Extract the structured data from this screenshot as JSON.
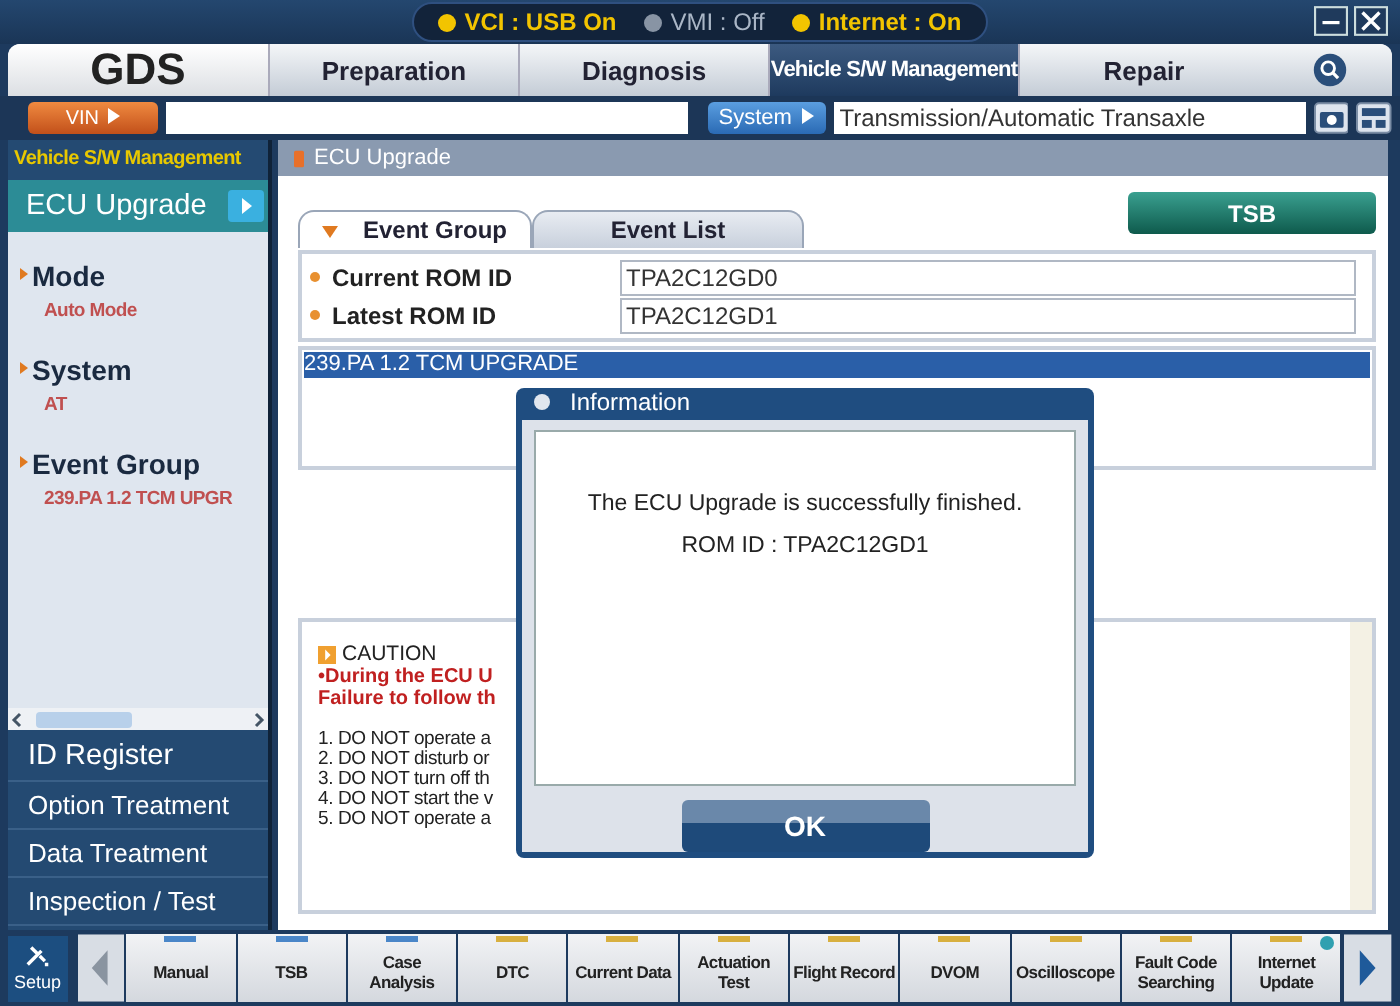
{
  "status_indicators": [
    {
      "label": "VCI : USB On",
      "on": true
    },
    {
      "label": "VMI : Off",
      "on": false
    },
    {
      "label": "Internet : On",
      "on": true
    }
  ],
  "logo": "GDS",
  "nav_tabs": [
    {
      "label": "Preparation",
      "selected": false
    },
    {
      "label": "Diagnosis",
      "selected": false
    },
    {
      "label": "Vehicle S/W Management",
      "selected": true
    },
    {
      "label": "Repair",
      "selected": false
    }
  ],
  "vin": {
    "button": "VIN"
  },
  "system": {
    "button": "System",
    "value": "Transmission/Automatic Transaxle"
  },
  "sidebar": {
    "title": "Vehicle S/W Management",
    "current": "ECU Upgrade",
    "sections": [
      {
        "label": "Mode",
        "value": "Auto Mode"
      },
      {
        "label": "System",
        "value": "AT"
      },
      {
        "label": "Event Group",
        "value": "239.PA 1.2 TCM UPGR"
      }
    ],
    "menu": [
      "ID Register",
      "Option Treatment",
      "Data Treatment",
      "Inspection / Test"
    ]
  },
  "breadcrumb": "ECU Upgrade",
  "content_tabs": [
    {
      "label": "Event Group",
      "selected": true
    },
    {
      "label": "Event List",
      "selected": false
    }
  ],
  "tsb_button": "TSB",
  "rom_ids": [
    {
      "label": "Current ROM ID",
      "value": "TPA2C12GD0"
    },
    {
      "label": "Latest ROM ID",
      "value": "TPA2C12GD1"
    }
  ],
  "events": [
    {
      "label": "239.PA 1.2 TCM UPGRADE",
      "selected": true
    }
  ],
  "caution": {
    "title": "CAUTION",
    "warning": [
      "•During the ECU U",
      "Failure to follow th"
    ],
    "steps": [
      "1. DO NOT operate a",
      "2. DO NOT disturb or",
      "3. DO NOT turn off th",
      "4. DO NOT start the v",
      "5. DO NOT operate a"
    ]
  },
  "dialog": {
    "title": "Information",
    "message": "The ECU Upgrade is successfully finished.",
    "detail": "ROM ID : TPA2C12GD1",
    "button": "OK"
  },
  "toolbar": {
    "setup": "Setup",
    "items": [
      {
        "label": "Manual",
        "color": "#4a86c8",
        "notice": false
      },
      {
        "label": "TSB",
        "color": "#4a86c8",
        "notice": false
      },
      {
        "label": "Case Analysis",
        "color": "#4a86c8",
        "notice": false
      },
      {
        "label": "DTC",
        "color": "#d8b040",
        "notice": false
      },
      {
        "label": "Current Data",
        "color": "#d8b040",
        "notice": false
      },
      {
        "label": "Actuation Test",
        "color": "#d8b040",
        "notice": false
      },
      {
        "label": "Flight Record",
        "color": "#d8b040",
        "notice": false
      },
      {
        "label": "DVOM",
        "color": "#d8b040",
        "notice": false
      },
      {
        "label": "Oscilloscope",
        "color": "#d8b040",
        "notice": false
      },
      {
        "label": "Fault Code Searching",
        "color": "#d8b040",
        "notice": false
      },
      {
        "label": "Internet Update",
        "color": "#d8b040",
        "notice": true
      }
    ]
  }
}
